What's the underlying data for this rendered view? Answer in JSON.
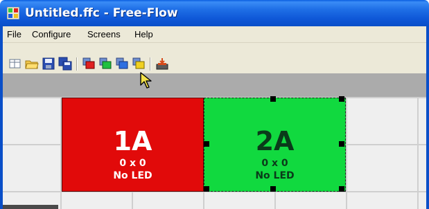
{
  "window": {
    "title": "Untitled.ffc - Free-Flow"
  },
  "menu": {
    "items": [
      "File",
      "Configure",
      "Screens",
      "Help"
    ]
  },
  "toolbar": {
    "buttons": [
      "new-file-icon",
      "open-folder-icon",
      "save-icon",
      "save-as-icon",
      "screen-red-icon",
      "screen-green-icon",
      "screen-blue-icon",
      "screen-yellow-icon",
      "export-icon"
    ]
  },
  "screens": [
    {
      "id": "1A",
      "dimensions": "0 x 0",
      "led": "No LED",
      "color": "#e10a0a",
      "selected": false
    },
    {
      "id": "2A",
      "dimensions": "0 x 0",
      "led": "No LED",
      "color": "#11d93f",
      "selected": true
    }
  ]
}
